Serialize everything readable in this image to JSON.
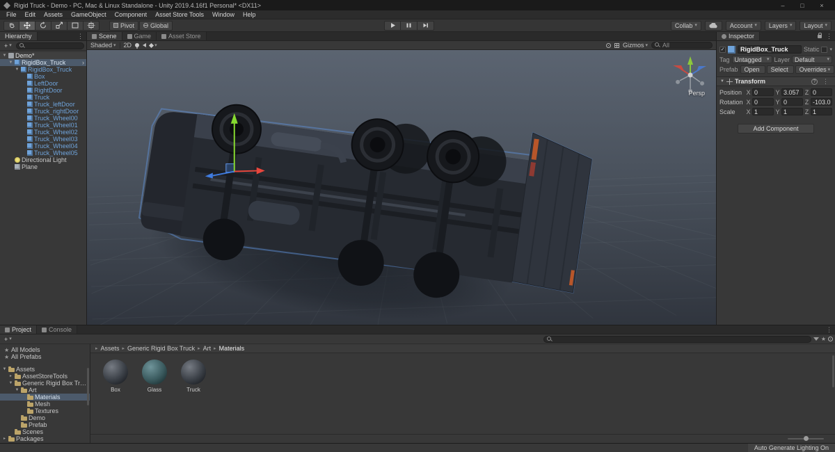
{
  "ui": {
    "plus": "+",
    "dd": "▾",
    "fold": "▼",
    "crumb_sep": "▸",
    "dots": "⋮",
    "check": "✓",
    "help": "?",
    "star": "★",
    "minimize": "–",
    "maximize": "□",
    "close": "×"
  },
  "window": {
    "title": "Rigid Truck - Demo - PC, Mac & Linux Standalone - Unity 2019.4.16f1 Personal* <DX11>"
  },
  "menu_bar": {
    "items": [
      "File",
      "Edit",
      "Assets",
      "GameObject",
      "Component",
      "Asset Store Tools",
      "Window",
      "Help"
    ]
  },
  "toolbar": {
    "pivot": "Pivot",
    "global": "Global",
    "collab": "Collab",
    "account": "Account",
    "layers": "Layers",
    "layout": "Layout"
  },
  "hierarchy": {
    "title": "Hierarchy",
    "items": [
      {
        "label": "Demo*",
        "level": 0,
        "arrow": "▼",
        "icon": "scene",
        "type": "scene"
      },
      {
        "label": "RigidBox_Truck",
        "level": 1,
        "arrow": "▼",
        "icon": "prefab",
        "type": "prefab",
        "selected": true,
        "nav": "›"
      },
      {
        "label": "RigidBox_Truck",
        "level": 2,
        "arrow": "▼",
        "icon": "prefab",
        "type": "prefab"
      },
      {
        "label": "Box",
        "level": 3,
        "icon": "prefab",
        "type": "prefab"
      },
      {
        "label": "LeftDoor",
        "level": 3,
        "icon": "prefab",
        "type": "prefab"
      },
      {
        "label": "RightDoor",
        "level": 3,
        "icon": "prefab",
        "type": "prefab"
      },
      {
        "label": "Truck",
        "level": 3,
        "icon": "prefab",
        "type": "prefab"
      },
      {
        "label": "Truck_leftDoor",
        "level": 3,
        "icon": "prefab",
        "type": "prefab"
      },
      {
        "label": "Truck_rightDoor",
        "level": 3,
        "icon": "prefab",
        "type": "prefab"
      },
      {
        "label": "Truck_Wheel00",
        "level": 3,
        "icon": "prefab",
        "type": "prefab"
      },
      {
        "label": "Truck_Wheel01",
        "level": 3,
        "icon": "prefab",
        "type": "prefab"
      },
      {
        "label": "Truck_Wheel02",
        "level": 3,
        "icon": "prefab",
        "type": "prefab"
      },
      {
        "label": "Truck_Wheel03",
        "level": 3,
        "icon": "prefab",
        "type": "prefab"
      },
      {
        "label": "Truck_Wheel04",
        "level": 3,
        "icon": "prefab",
        "type": "prefab"
      },
      {
        "label": "Truck_Wheel05",
        "level": 3,
        "icon": "prefab",
        "type": "prefab"
      },
      {
        "label": "Directional Light",
        "level": 1,
        "icon": "light",
        "type": "object"
      },
      {
        "label": "Plane",
        "level": 1,
        "icon": "plane",
        "type": "object"
      }
    ]
  },
  "scene_view": {
    "tabs": [
      {
        "label": "Scene",
        "active": true
      },
      {
        "label": "Game"
      },
      {
        "label": "Asset Store"
      }
    ],
    "shading_mode": "Shaded",
    "mode_2d": "2D",
    "gizmos_label": "Gizmos",
    "search_value": "All",
    "persp_label": "Persp"
  },
  "inspector": {
    "title": "Inspector",
    "object_name": "RigidBox_Truck",
    "static_label": "Static",
    "tag_label": "Tag",
    "tag_value": "Untagged",
    "layer_label": "Layer",
    "layer_value": "Default",
    "prefab_label": "Prefab",
    "prefab_buttons": [
      {
        "label": "Open"
      },
      {
        "label": "Select"
      },
      {
        "label": "Overrides",
        "arrow": "▾"
      }
    ],
    "transform": {
      "title": "Transform",
      "rows": [
        {
          "label": "Position",
          "xl": "X",
          "x": "0",
          "yl": "Y",
          "y": "3.057",
          "zl": "Z",
          "z": "0"
        },
        {
          "label": "Rotation",
          "xl": "X",
          "x": "0",
          "yl": "Y",
          "y": "0",
          "zl": "Z",
          "z": "-103.0"
        },
        {
          "label": "Scale",
          "xl": "X",
          "x": "1",
          "yl": "Y",
          "y": "1",
          "zl": "Z",
          "z": "1"
        }
      ]
    },
    "add_component": "Add Component"
  },
  "project": {
    "tabs": [
      {
        "label": "Project",
        "active": true
      },
      {
        "label": "Console"
      }
    ],
    "favorites": [
      {
        "label": "All Models",
        "icon": "star"
      },
      {
        "label": "All Prefabs",
        "icon": "star"
      }
    ],
    "tree": [
      {
        "label": "Assets",
        "level": 0,
        "arrow": "▼",
        "icon": "folder"
      },
      {
        "label": "AssetStoreTools",
        "level": 1,
        "arrow": "▸",
        "icon": "folder"
      },
      {
        "label": "Generic Rigid Box Truck",
        "level": 1,
        "arrow": "▼",
        "icon": "folder"
      },
      {
        "label": "Art",
        "level": 2,
        "arrow": "▼",
        "icon": "folder"
      },
      {
        "label": "Materials",
        "level": 3,
        "icon": "folder",
        "selected": true
      },
      {
        "label": "Mesh",
        "level": 3,
        "icon": "folder"
      },
      {
        "label": "Textures",
        "level": 3,
        "icon": "folder"
      },
      {
        "label": "Demo",
        "level": 2,
        "icon": "folder"
      },
      {
        "label": "Prefab",
        "level": 2,
        "icon": "folder"
      },
      {
        "label": "Scenes",
        "level": 1,
        "icon": "folder"
      },
      {
        "label": "Packages",
        "level": 0,
        "arrow": "▸",
        "icon": "folder"
      }
    ],
    "breadcrumb": [
      "Assets",
      "Generic Rigid Box Truck",
      "Art",
      "Materials"
    ],
    "assets": [
      {
        "label": "Box",
        "kind": "metal"
      },
      {
        "label": "Glass",
        "kind": "glass"
      },
      {
        "label": "Truck",
        "kind": "metal"
      }
    ]
  },
  "status_bar": {
    "lighting": "Auto Generate Lighting On"
  },
  "colors": {
    "selection": "#4C5A6B",
    "prefab_text": "#6FA3DA",
    "folder": "#BCA469",
    "axis_x": "#E8463C",
    "axis_y": "#86D930",
    "axis_z": "#3F7CE0"
  }
}
